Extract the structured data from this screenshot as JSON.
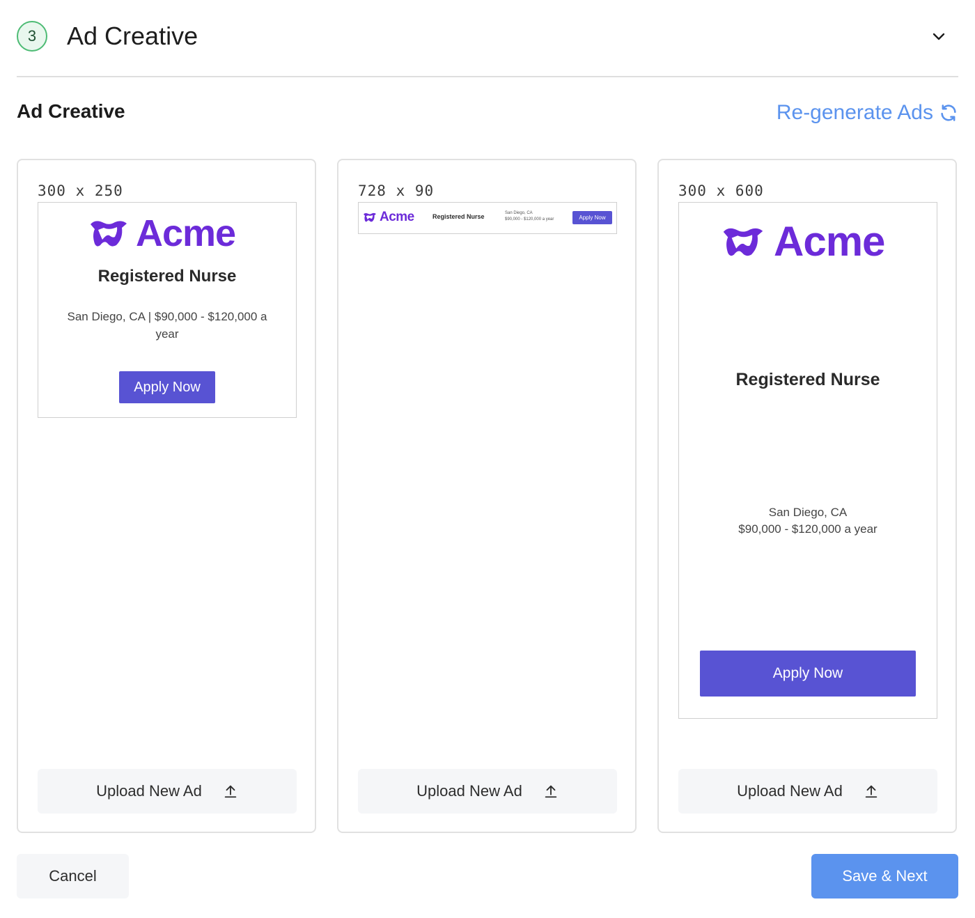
{
  "step": {
    "number": "3",
    "title": "Ad Creative"
  },
  "section": {
    "title": "Ad Creative",
    "regenerate_label": "Re-generate Ads"
  },
  "colors": {
    "accent": "#5b93ee",
    "apply": "#5853d3",
    "brand": "#6c2bd9",
    "step_green": "#4dbb74"
  },
  "ad": {
    "brand": "Acme",
    "job_title": "Registered Nurse",
    "location": "San Diego, CA",
    "salary": "$90,000 - $120,000 a year",
    "location_salary_line": "San Diego, CA | $90,000 - $120,000 a",
    "location_salary_wrap": "year",
    "cta": "Apply Now"
  },
  "cards": [
    {
      "size": "300 x 250",
      "upload_label": "Upload New Ad"
    },
    {
      "size": "728 x 90",
      "upload_label": "Upload New Ad"
    },
    {
      "size": "300 x 600",
      "upload_label": "Upload New Ad"
    }
  ],
  "footer": {
    "cancel_label": "Cancel",
    "save_label": "Save & Next"
  }
}
